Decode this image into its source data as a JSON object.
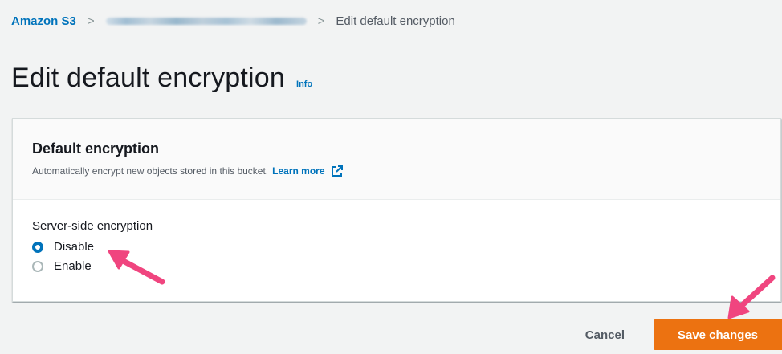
{
  "breadcrumb": {
    "root": "Amazon S3",
    "separator": ">",
    "current": "Edit default encryption"
  },
  "page": {
    "title": "Edit default encryption",
    "info": "Info"
  },
  "panel": {
    "title": "Default encryption",
    "description": "Automatically encrypt new objects stored in this bucket.",
    "learn_more": "Learn more",
    "field_label": "Server-side encryption",
    "options": [
      {
        "label": "Disable",
        "selected": true
      },
      {
        "label": "Enable",
        "selected": false
      }
    ]
  },
  "actions": {
    "cancel": "Cancel",
    "save": "Save changes"
  },
  "colors": {
    "link": "#0073bb",
    "primary_button": "#ec7211",
    "annotation_arrow": "#f0457f"
  },
  "icons": {
    "external_link": "external-link-icon",
    "annotation": "annotation-arrow-icon"
  }
}
